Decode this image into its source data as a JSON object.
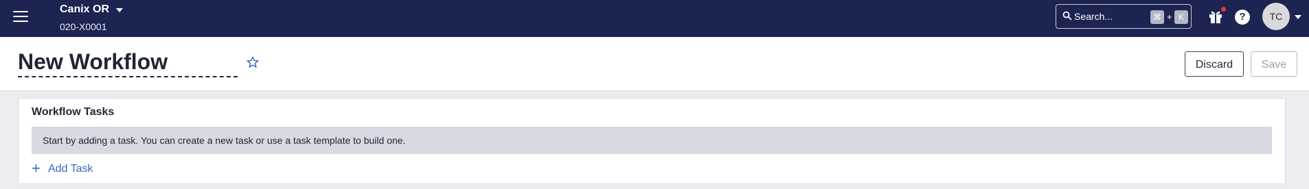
{
  "topbar": {
    "menu_icon": "hamburger-menu-icon",
    "org": {
      "name": "Canix OR",
      "code": "020-X0001"
    },
    "search": {
      "placeholder": "Search...",
      "shortcut_mod": "⌘",
      "shortcut_plus": "+",
      "shortcut_key": "K"
    },
    "help_label": "?",
    "avatar_initials": "TC",
    "colors": {
      "bar": "#1c2452",
      "notification_dot": "#e53935"
    }
  },
  "header": {
    "title": "New Workflow",
    "discard_label": "Discard",
    "save_label": "Save"
  },
  "card": {
    "title": "Workflow Tasks",
    "empty_message": "Start by adding a task. You can create a new task or use a task template to build one.",
    "add_task_label": "Add Task",
    "add_icon": "+",
    "accent_color": "#3a66c4"
  }
}
